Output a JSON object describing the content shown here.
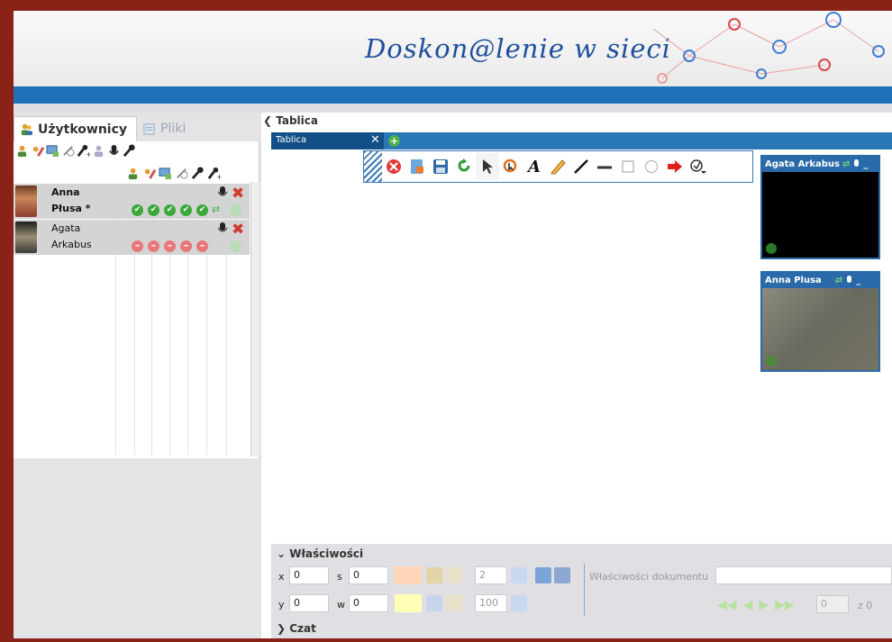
{
  "header": {
    "brand_text": "Doskon@lenie w sieci",
    "accent_color": "#1d72b8",
    "frame_color": "#8b2218"
  },
  "left_tabs": [
    {
      "label": "Użytkownicy",
      "icon": "users-icon",
      "active": true
    },
    {
      "label": "Pliki",
      "icon": "files-icon",
      "active": false
    }
  ],
  "users": [
    {
      "first": "Anna",
      "last": "Płusa *",
      "rights": "granted",
      "mic": true
    },
    {
      "first": "Agata",
      "last": "Arkabus",
      "rights": "denied",
      "mic": true
    }
  ],
  "main": {
    "title": "Tablica",
    "whiteboard_tab": "Tablica",
    "toolbar_icons": [
      "close-icon",
      "new-document-icon",
      "save-icon",
      "refresh-icon",
      "pointer-icon",
      "zoom-icon",
      "text-icon",
      "pencil-icon",
      "line-icon",
      "underline-icon",
      "rectangle-icon",
      "ellipse-icon",
      "arrow-icon",
      "clear-icon"
    ]
  },
  "videos": [
    {
      "name": "Agata Arkabus",
      "state": "off"
    },
    {
      "name": "Anna Plusa",
      "state": "on"
    }
  ],
  "properties": {
    "title": "Właściwości",
    "x_label": "x",
    "x_value": "0",
    "y_label": "y",
    "y_value": "0",
    "s_label": "s",
    "s_value": "0",
    "w_label": "w",
    "w_value": "0",
    "stroke_width": "2",
    "opacity": "100",
    "doc_label": "Właściwości dokumentu",
    "page_number": "0",
    "zoom_text": "z 0"
  },
  "chat": {
    "title": "Czat"
  }
}
